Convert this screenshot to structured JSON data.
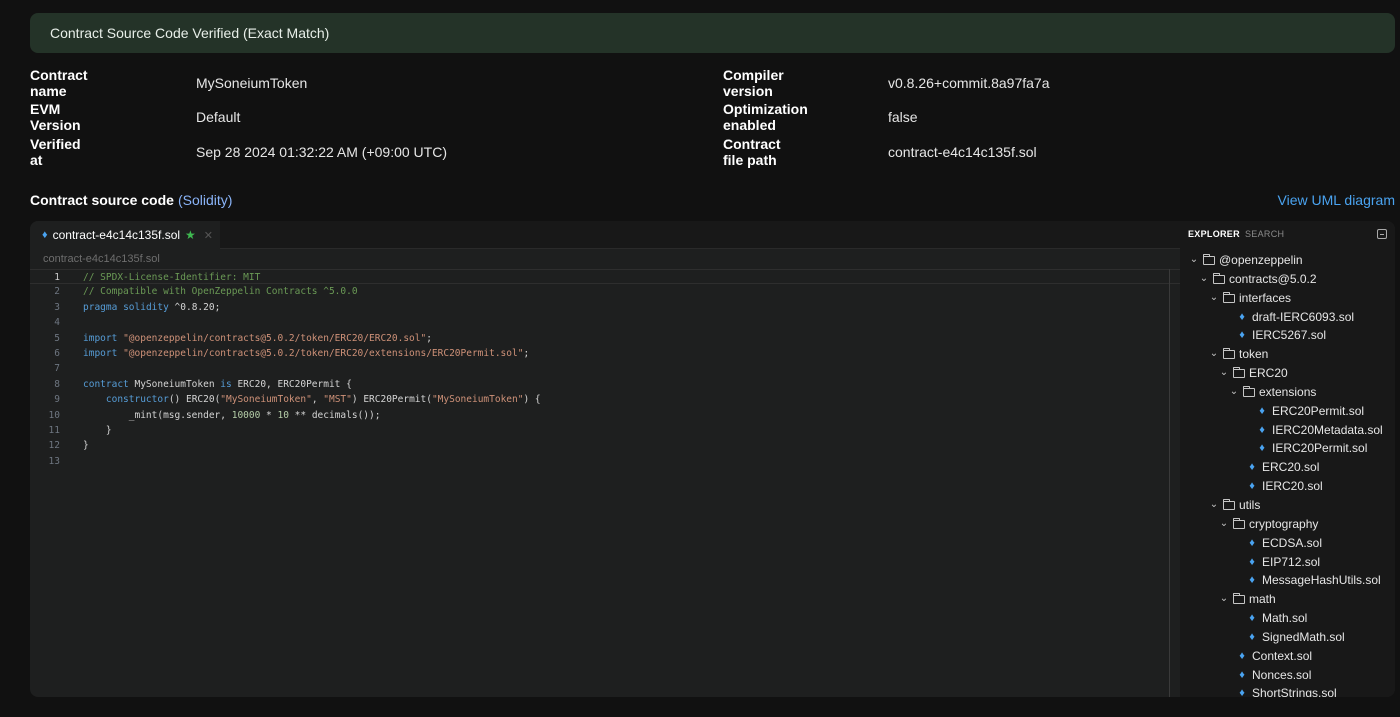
{
  "banner": {
    "text": "Contract Source Code Verified (Exact Match)"
  },
  "info": {
    "left": [
      {
        "label": "Contract name",
        "value": "MySoneiumToken"
      },
      {
        "label": "EVM Version",
        "value": "Default"
      },
      {
        "label": "Verified at",
        "value": "Sep 28 2024 01:32:22 AM (+09:00 UTC)"
      }
    ],
    "right": [
      {
        "label": "Compiler version",
        "value": "v0.8.26+commit.8a97fa7a"
      },
      {
        "label": "Optimization enabled",
        "value": "false"
      },
      {
        "label": "Contract file path",
        "value": "contract-e4c14c135f.sol"
      }
    ]
  },
  "source": {
    "title": "Contract source code",
    "language": "(Solidity)",
    "uml_link": "View UML diagram"
  },
  "editor": {
    "tab_label": "contract-e4c14c135f.sol",
    "breadcrumb": "contract-e4c14c135f.sol",
    "lines": [
      {
        "n": "1",
        "tokens": [
          {
            "t": "// SPDX-License-Identifier: MIT",
            "c": "cm"
          }
        ]
      },
      {
        "n": "2",
        "tokens": [
          {
            "t": "// Compatible with OpenZeppelin Contracts ^5.0.0",
            "c": "cm"
          }
        ]
      },
      {
        "n": "3",
        "tokens": [
          {
            "t": "pragma",
            "c": "kw"
          },
          {
            "t": " "
          },
          {
            "t": "solidity",
            "c": "kw"
          },
          {
            "t": " ^0.8.20;"
          }
        ]
      },
      {
        "n": "4",
        "tokens": []
      },
      {
        "n": "5",
        "tokens": [
          {
            "t": "import",
            "c": "kw"
          },
          {
            "t": " "
          },
          {
            "t": "\"@openzeppelin/contracts@5.0.2/token/ERC20/ERC20.sol\"",
            "c": "str"
          },
          {
            "t": ";"
          }
        ]
      },
      {
        "n": "6",
        "tokens": [
          {
            "t": "import",
            "c": "kw"
          },
          {
            "t": " "
          },
          {
            "t": "\"@openzeppelin/contracts@5.0.2/token/ERC20/extensions/ERC20Permit.sol\"",
            "c": "str"
          },
          {
            "t": ";"
          }
        ]
      },
      {
        "n": "7",
        "tokens": []
      },
      {
        "n": "8",
        "tokens": [
          {
            "t": "contract",
            "c": "kw"
          },
          {
            "t": " MySoneiumToken "
          },
          {
            "t": "is",
            "c": "kw"
          },
          {
            "t": " ERC20, ERC20Permit {"
          }
        ]
      },
      {
        "n": "9",
        "tokens": [
          {
            "t": "    "
          },
          {
            "t": "constructor",
            "c": "kw"
          },
          {
            "t": "() ERC20("
          },
          {
            "t": "\"MySoneiumToken\"",
            "c": "str"
          },
          {
            "t": ", "
          },
          {
            "t": "\"MST\"",
            "c": "str"
          },
          {
            "t": ") ERC20Permit("
          },
          {
            "t": "\"MySoneiumToken\"",
            "c": "str"
          },
          {
            "t": ") {"
          }
        ]
      },
      {
        "n": "10",
        "tokens": [
          {
            "t": "        _mint(msg.sender, "
          },
          {
            "t": "10000",
            "c": "num"
          },
          {
            "t": " * "
          },
          {
            "t": "10",
            "c": "num"
          },
          {
            "t": " ** decimals());"
          }
        ]
      },
      {
        "n": "11",
        "tokens": [
          {
            "t": "    }"
          }
        ]
      },
      {
        "n": "12",
        "tokens": [
          {
            "t": "}"
          }
        ]
      },
      {
        "n": "13",
        "tokens": []
      }
    ]
  },
  "explorer": {
    "tab_explorer": "EXPLORER",
    "tab_search": "SEARCH",
    "tree": [
      {
        "name": "@openzeppelin",
        "type": "folder",
        "depth": 0
      },
      {
        "name": "contracts@5.0.2",
        "type": "folder",
        "depth": 1
      },
      {
        "name": "interfaces",
        "type": "folder",
        "depth": 2
      },
      {
        "name": "draft-IERC6093.sol",
        "type": "file",
        "depth": 3
      },
      {
        "name": "IERC5267.sol",
        "type": "file",
        "depth": 3
      },
      {
        "name": "token",
        "type": "folder",
        "depth": 2
      },
      {
        "name": "ERC20",
        "type": "folder",
        "depth": 3
      },
      {
        "name": "extensions",
        "type": "folder",
        "depth": 4
      },
      {
        "name": "ERC20Permit.sol",
        "type": "file",
        "depth": 5
      },
      {
        "name": "IERC20Metadata.sol",
        "type": "file",
        "depth": 5
      },
      {
        "name": "IERC20Permit.sol",
        "type": "file",
        "depth": 5
      },
      {
        "name": "ERC20.sol",
        "type": "file",
        "depth": 4
      },
      {
        "name": "IERC20.sol",
        "type": "file",
        "depth": 4
      },
      {
        "name": "utils",
        "type": "folder",
        "depth": 2
      },
      {
        "name": "cryptography",
        "type": "folder",
        "depth": 3
      },
      {
        "name": "ECDSA.sol",
        "type": "file",
        "depth": 4
      },
      {
        "name": "EIP712.sol",
        "type": "file",
        "depth": 4
      },
      {
        "name": "MessageHashUtils.sol",
        "type": "file",
        "depth": 4
      },
      {
        "name": "math",
        "type": "folder",
        "depth": 3
      },
      {
        "name": "Math.sol",
        "type": "file",
        "depth": 4
      },
      {
        "name": "SignedMath.sol",
        "type": "file",
        "depth": 4
      },
      {
        "name": "Context.sol",
        "type": "file",
        "depth": 3
      },
      {
        "name": "Nonces.sol",
        "type": "file",
        "depth": 3
      },
      {
        "name": "ShortStrings.sol",
        "type": "file",
        "depth": 3
      }
    ]
  }
}
